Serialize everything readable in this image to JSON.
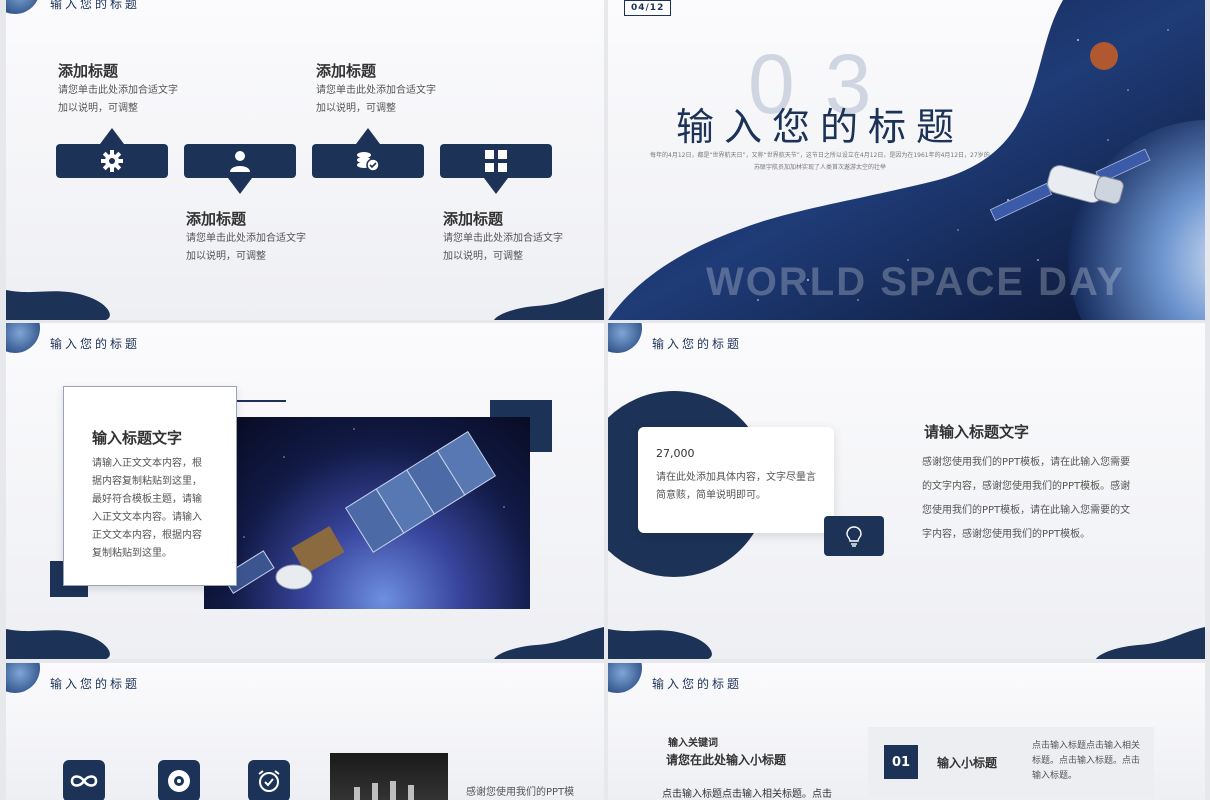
{
  "colors": {
    "navy": "#1c3257",
    "text": "#333333",
    "muted": "#555555"
  },
  "slide1": {
    "header": "输入您的标题",
    "items": [
      {
        "title": "添加标题",
        "desc1": "请您单击此处添加合适文字",
        "desc2": "加以说明，可调整",
        "icon": "gear-icon"
      },
      {
        "title": "添加标题",
        "desc1": "请您单击此处添加合适文字",
        "desc2": "加以说明，可调整",
        "icon": "user-icon"
      },
      {
        "title": "添加标题",
        "desc1": "请您单击此处添加合适文字",
        "desc2": "加以说明，可调整",
        "icon": "coins-icon"
      },
      {
        "title": "添加标题",
        "desc1": "请您单击此处添加合适文字",
        "desc2": "加以说明，可调整",
        "icon": "grid-icon"
      }
    ]
  },
  "slide2": {
    "page_badge": "04/12",
    "big_number": "03",
    "title": "输入您的标题",
    "fine1": "每年的4月12日，都是“世界航天日”，又称“世界航天节”，这节日之所以设立在4月12日，是因为在1961年的4月12日，27岁的前",
    "fine2": "苏联宇航员加加林实现了人类首次遨游太空的壮举",
    "watermark": "WORLD SPACE DAY"
  },
  "slide3": {
    "header": "输入您的标题",
    "card_title": "输入标题文字",
    "card_body": "请输入正文文本内容，根据内容复制粘贴到这里，最好符合模板主题，请输入正文文本内容。请输入正文文本内容，根据内容复制粘贴到这里。"
  },
  "slide4": {
    "header": "输入您的标题",
    "card_number": "27,000",
    "card_text": "请在此处添加具体内容，文字尽量言简意赅，简单说明即可。",
    "title": "请输入标题文字",
    "body": "感谢您使用我们的PPT模板，请在此输入您需要的文字内容，感谢您使用我们的PPT模板。感谢您使用我们的PPT模板，请在此输入您需要的文字内容，感谢您使用我们的PPT模板。",
    "icon": "lightbulb-icon"
  },
  "slide5": {
    "header": "输入您的标题",
    "icons": [
      "infinity-icon",
      "vinyl-icon",
      "alarm-clock-icon"
    ],
    "side_text": "感谢您使用我们的PPT模"
  },
  "slide6": {
    "header": "输入您的标题",
    "keyword": "输入关键词",
    "subtitle": "请您在此处输入小标题",
    "body": "点击输入标题点击输入相关标题。点击",
    "number": "01",
    "small_title": "输入小标题",
    "small_body": "点击输入标题点击输入相关标题。点击输入标题。点击输入标题。"
  }
}
